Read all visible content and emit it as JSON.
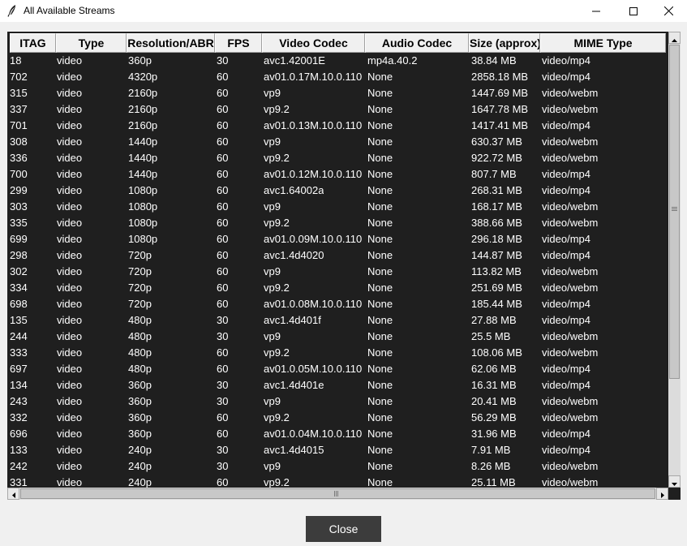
{
  "window": {
    "title": "All Available Streams",
    "app_icon": "feather-icon"
  },
  "controls": {
    "minimize_icon": "minimize-icon",
    "maximize_icon": "maximize-icon",
    "close_icon": "close-icon"
  },
  "table": {
    "columns": [
      "ITAG",
      "Type",
      "Resolution/ABR",
      "FPS",
      "Video Codec",
      "Audio Codec",
      "Size (approx)",
      "MIME Type"
    ],
    "rows": [
      [
        "18",
        "video",
        "360p",
        "30",
        "avc1.42001E",
        "mp4a.40.2",
        "38.84 MB",
        "video/mp4"
      ],
      [
        "702",
        "video",
        "4320p",
        "60",
        "av01.0.17M.10.0.110",
        "None",
        "2858.18 MB",
        "video/mp4"
      ],
      [
        "315",
        "video",
        "2160p",
        "60",
        "vp9",
        "None",
        "1447.69 MB",
        "video/webm"
      ],
      [
        "337",
        "video",
        "2160p",
        "60",
        "vp9.2",
        "None",
        "1647.78 MB",
        "video/webm"
      ],
      [
        "701",
        "video",
        "2160p",
        "60",
        "av01.0.13M.10.0.110",
        "None",
        "1417.41 MB",
        "video/mp4"
      ],
      [
        "308",
        "video",
        "1440p",
        "60",
        "vp9",
        "None",
        "630.37 MB",
        "video/webm"
      ],
      [
        "336",
        "video",
        "1440p",
        "60",
        "vp9.2",
        "None",
        "922.72 MB",
        "video/webm"
      ],
      [
        "700",
        "video",
        "1440p",
        "60",
        "av01.0.12M.10.0.110",
        "None",
        "807.7 MB",
        "video/mp4"
      ],
      [
        "299",
        "video",
        "1080p",
        "60",
        "avc1.64002a",
        "None",
        "268.31 MB",
        "video/mp4"
      ],
      [
        "303",
        "video",
        "1080p",
        "60",
        "vp9",
        "None",
        "168.17 MB",
        "video/webm"
      ],
      [
        "335",
        "video",
        "1080p",
        "60",
        "vp9.2",
        "None",
        "388.66 MB",
        "video/webm"
      ],
      [
        "699",
        "video",
        "1080p",
        "60",
        "av01.0.09M.10.0.110",
        "None",
        "296.18 MB",
        "video/mp4"
      ],
      [
        "298",
        "video",
        "720p",
        "60",
        "avc1.4d4020",
        "None",
        "144.87 MB",
        "video/mp4"
      ],
      [
        "302",
        "video",
        "720p",
        "60",
        "vp9",
        "None",
        "113.82 MB",
        "video/webm"
      ],
      [
        "334",
        "video",
        "720p",
        "60",
        "vp9.2",
        "None",
        "251.69 MB",
        "video/webm"
      ],
      [
        "698",
        "video",
        "720p",
        "60",
        "av01.0.08M.10.0.110",
        "None",
        "185.44 MB",
        "video/mp4"
      ],
      [
        "135",
        "video",
        "480p",
        "30",
        "avc1.4d401f",
        "None",
        "27.88 MB",
        "video/mp4"
      ],
      [
        "244",
        "video",
        "480p",
        "30",
        "vp9",
        "None",
        "25.5 MB",
        "video/webm"
      ],
      [
        "333",
        "video",
        "480p",
        "60",
        "vp9.2",
        "None",
        "108.06 MB",
        "video/webm"
      ],
      [
        "697",
        "video",
        "480p",
        "60",
        "av01.0.05M.10.0.110",
        "None",
        "62.06 MB",
        "video/mp4"
      ],
      [
        "134",
        "video",
        "360p",
        "30",
        "avc1.4d401e",
        "None",
        "16.31 MB",
        "video/mp4"
      ],
      [
        "243",
        "video",
        "360p",
        "30",
        "vp9",
        "None",
        "20.41 MB",
        "video/webm"
      ],
      [
        "332",
        "video",
        "360p",
        "60",
        "vp9.2",
        "None",
        "56.29 MB",
        "video/webm"
      ],
      [
        "696",
        "video",
        "360p",
        "60",
        "av01.0.04M.10.0.110",
        "None",
        "31.96 MB",
        "video/mp4"
      ],
      [
        "133",
        "video",
        "240p",
        "30",
        "avc1.4d4015",
        "None",
        "7.91 MB",
        "video/mp4"
      ],
      [
        "242",
        "video",
        "240p",
        "30",
        "vp9",
        "None",
        "8.26 MB",
        "video/webm"
      ],
      [
        "331",
        "video",
        "240p",
        "60",
        "vp9.2",
        "None",
        "25.11 MB",
        "video/webm"
      ]
    ]
  },
  "footer": {
    "close_label": "Close"
  },
  "colors": {
    "table_background": "#1f1f1f",
    "table_text": "#ffffff",
    "button_background": "#3c3c3c"
  }
}
